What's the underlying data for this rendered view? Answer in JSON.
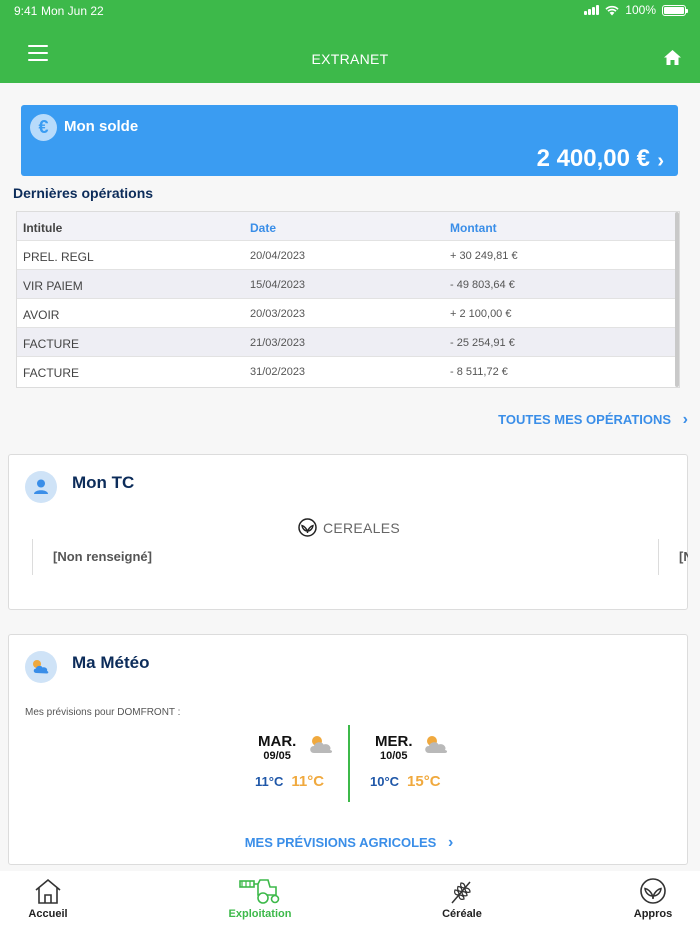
{
  "status_bar": {
    "time": "9:41",
    "date": "Mon Jun 22",
    "battery": "100%"
  },
  "header": {
    "title": "EXTRANET"
  },
  "balance": {
    "label": "Mon solde",
    "amount": "2 400,00 €"
  },
  "operations": {
    "section_title": "Dernières opérations",
    "columns": [
      "Intitule",
      "Date",
      "Montant"
    ],
    "rows": [
      {
        "label": "PREL. REGL",
        "date": "20/04/2023",
        "amount": "+ 30 249,81 €"
      },
      {
        "label": "VIR PAIEM",
        "date": "15/04/2023",
        "amount": "- 49 803,64 €"
      },
      {
        "label": "AVOIR",
        "date": "20/03/2023",
        "amount": "+ 2 100,00 €"
      },
      {
        "label": "FACTURE",
        "date": "21/03/2023",
        "amount": "- 25 254,91 €"
      },
      {
        "label": "FACTURE",
        "date": "31/02/2023",
        "amount": "- 8 511,72 €"
      }
    ],
    "all_link": "TOUTES MES OPÉRATIONS"
  },
  "tc_card": {
    "title": "Mon TC",
    "category": "CEREALES",
    "value": "[Non renseigné]",
    "next_value_cut": "[N"
  },
  "meteo_card": {
    "title": "Ma Météo",
    "subtitle": "Mes prévisions pour DOMFRONT :",
    "days": [
      {
        "name": "MAR.",
        "date": "09/05",
        "min": "11°C",
        "max": "11°C",
        "icon": "partly-cloudy-icon"
      },
      {
        "name": "MER.",
        "date": "10/05",
        "min": "10°C",
        "max": "15°C",
        "icon": "partly-cloudy-icon"
      }
    ],
    "forecast_link": "MES PRÉVISIONS AGRICOLES"
  },
  "tabs": [
    {
      "label": "Accueil",
      "icon": "house-icon",
      "active": false
    },
    {
      "label": "Exploitation",
      "icon": "harvester-icon",
      "active": true
    },
    {
      "label": "Céréale",
      "icon": "wheat-icon",
      "active": false
    },
    {
      "label": "Appros",
      "icon": "leaf-circle-icon",
      "active": false
    }
  ],
  "colors": {
    "brand_green": "#3db94a",
    "accent_blue": "#3a9cf2",
    "link_blue": "#3a8ee8",
    "max_temp": "#f0a93e",
    "min_temp": "#1f57a8"
  }
}
